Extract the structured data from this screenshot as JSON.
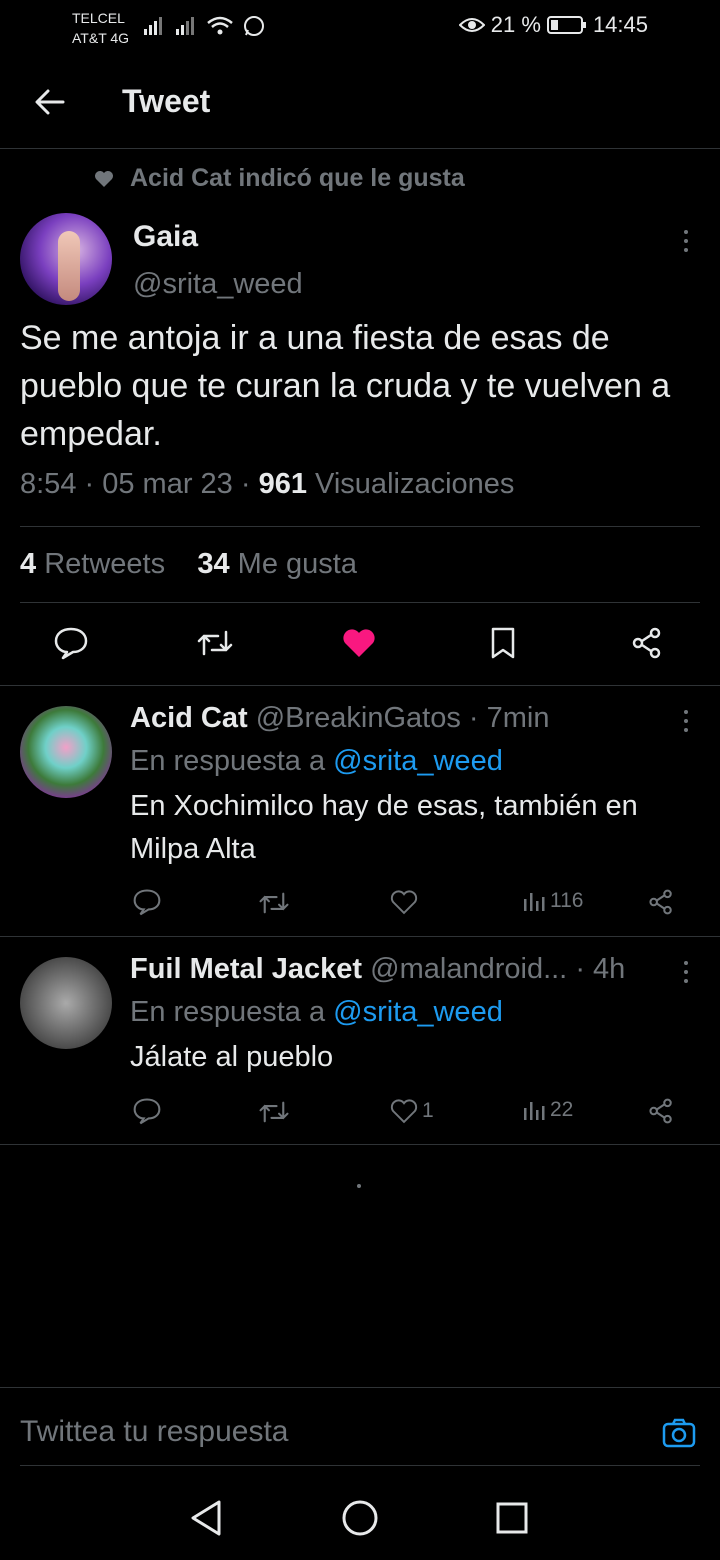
{
  "status_bar": {
    "carrier_1": "TELCEL",
    "carrier_2": "AT&T 4G",
    "battery": "21 %",
    "time": "14:45"
  },
  "header": {
    "title": "Tweet"
  },
  "social_context": "Acid Cat indicó que le gusta",
  "main_tweet": {
    "name": "Gaia",
    "handle": "@srita_weed",
    "text": "Se me antoja ir a una fiesta de esas de pueblo que te curan la cruda y te vuelven a empedar.",
    "time": "8:54",
    "date": "05 mar 23",
    "views_count": "961",
    "views_label": "Visualizaciones",
    "retweets_count": "4",
    "retweets_label": "Retweets",
    "likes_count": "34",
    "likes_label": "Me gusta",
    "liked": true,
    "like_color": "#f91880"
  },
  "replies": [
    {
      "name": "Acid Cat",
      "handle": "@BreakinGatos",
      "time": "· 7min",
      "reply_prefix": "En respuesta a",
      "reply_to": "@srita_weed",
      "text": "En Xochimilco hay de esas, también en Milpa Alta",
      "likes": "",
      "views": "116"
    },
    {
      "name": "Fuil Metal Jacket",
      "handle": "@malandroid...",
      "time": "· 4h",
      "reply_prefix": "En respuesta a",
      "reply_to": "@srita_weed",
      "text": "Jálate al pueblo",
      "likes": "1",
      "views": "22"
    }
  ],
  "compose": {
    "placeholder": "Twittea tu respuesta"
  },
  "colors": {
    "accent": "#1d9bf0",
    "text": "#e7e9ea",
    "muted": "#71767b",
    "divider": "#2f3336",
    "background": "#000000"
  }
}
